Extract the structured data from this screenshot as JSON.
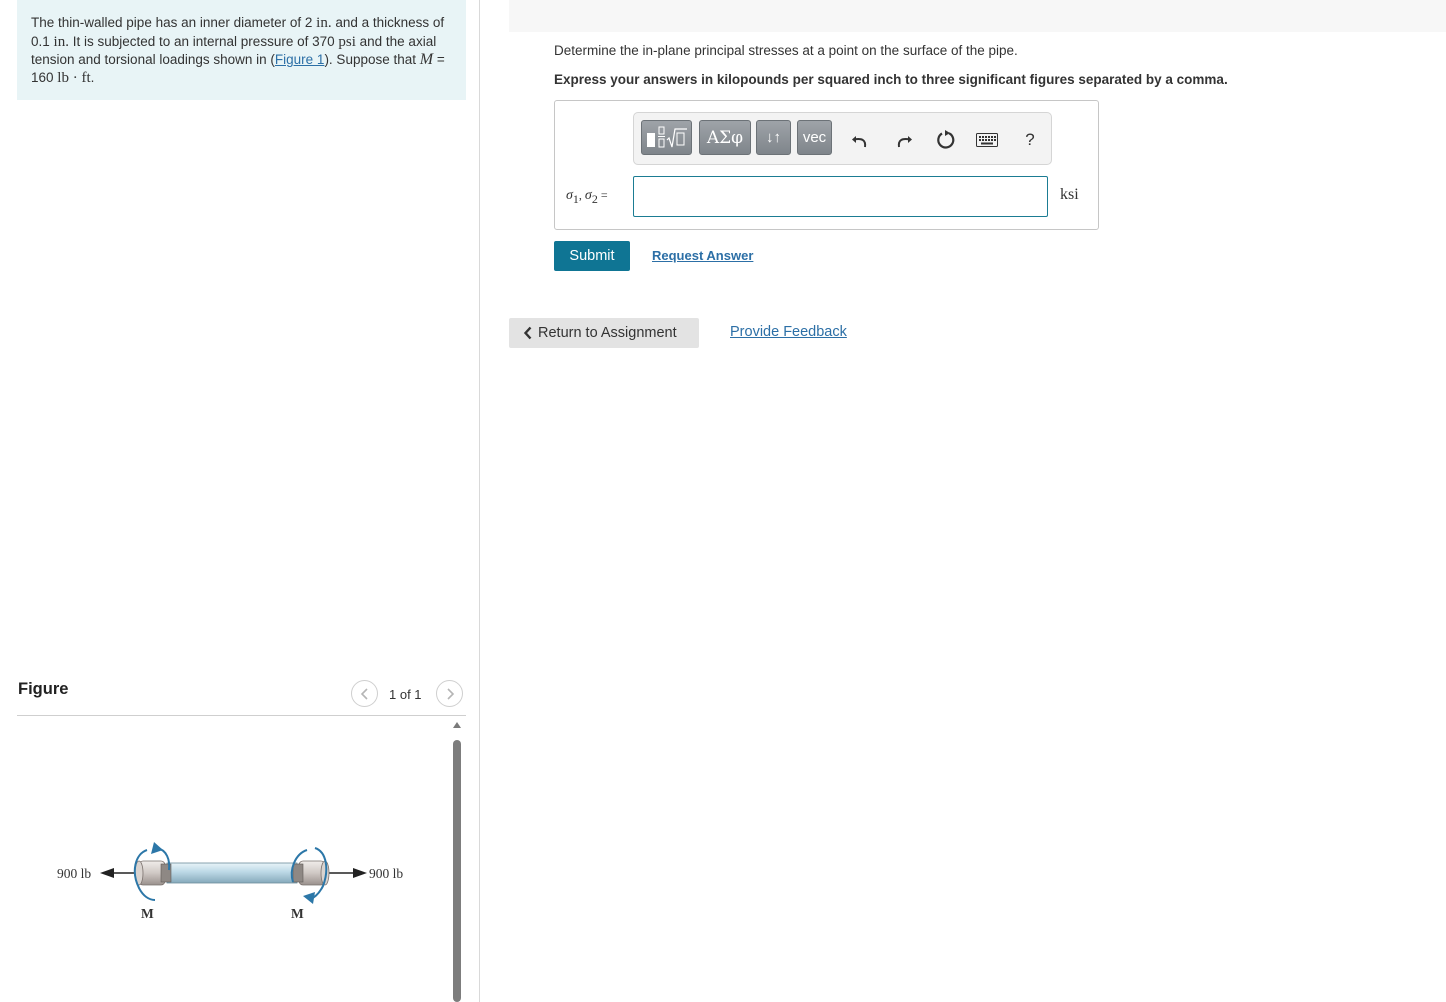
{
  "problem": {
    "p1": "The thin-walled pipe has an inner diameter of 2 ",
    "u_in1": "in.",
    "p2": " and a thickness of 0.1 ",
    "u_in2": "in.",
    "p3": " It is subjected to an internal pressure of 370 ",
    "u_psi": "psi",
    "p4": " and the axial tension and torsional loadings shown in (",
    "figure_link": "Figure 1",
    "p5": "). Suppose that ",
    "var_m": "M",
    "p6": " = 160 ",
    "u_lbft": "lb · ft",
    "p7": "."
  },
  "figure": {
    "title": "Figure",
    "page_indicator": "1 of 1",
    "left_force": "900 lb",
    "right_force": "900 lb",
    "left_moment": "M",
    "right_moment": "M"
  },
  "question": {
    "text": "Determine the in-plane principal stresses at a point on the surface of the pipe.",
    "instruction": "Express your answers in kilopounds per squared inch to three significant figures separated by a comma."
  },
  "answer": {
    "label_sigma1": "σ",
    "label_sub1": "1",
    "label_sep": ", ",
    "label_sigma2": "σ",
    "label_sub2": "2",
    "label_eq": " =",
    "value": "",
    "unit": "ksi"
  },
  "toolbar": {
    "greek_label": "ΑΣφ",
    "arrows_label": "↓↑",
    "vec_label": "vec",
    "help_label": "?"
  },
  "actions": {
    "submit": "Submit",
    "request_answer": "Request Answer",
    "return": "Return to Assignment",
    "feedback": "Provide Feedback"
  }
}
